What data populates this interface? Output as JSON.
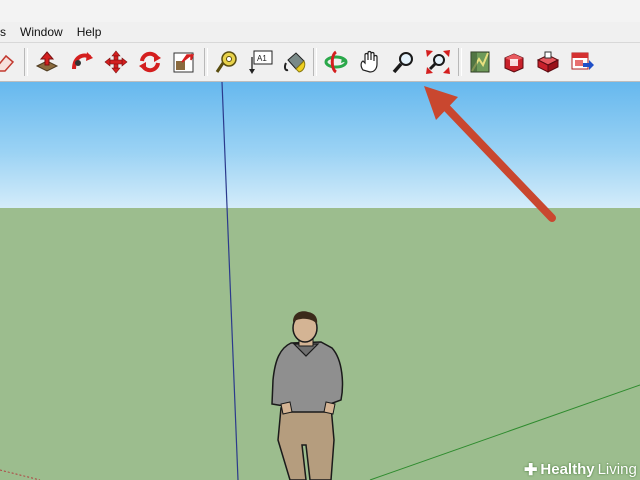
{
  "menu": {
    "items": [
      {
        "label": "s"
      },
      {
        "label": "Window"
      },
      {
        "label": "Help"
      }
    ]
  },
  "toolbar": {
    "tools": [
      {
        "icon": "eraser-icon"
      },
      {
        "icon": "push-pull-icon"
      },
      {
        "icon": "follow-me-icon"
      },
      {
        "icon": "move-icon"
      },
      {
        "icon": "rotate-icon"
      },
      {
        "icon": "scale-icon"
      },
      {
        "icon": "tape-measure-icon"
      },
      {
        "icon": "text-tool-icon",
        "text": "A1"
      },
      {
        "icon": "paint-bucket-icon"
      },
      {
        "icon": "orbit-icon"
      },
      {
        "icon": "pan-icon"
      },
      {
        "icon": "zoom-icon"
      },
      {
        "icon": "zoom-extents-icon"
      },
      {
        "icon": "add-location-icon"
      },
      {
        "icon": "get-models-icon"
      },
      {
        "icon": "share-model-icon"
      },
      {
        "icon": "send-to-google-earth-icon"
      }
    ]
  },
  "annotation": {
    "icon": "arrow-pointer-icon",
    "color": "#c9472f"
  },
  "watermark": {
    "brand_bold": "Healthy",
    "brand_thin": "Living"
  },
  "colors": {
    "sky_top": "#66b8ee",
    "ground": "#9cbd8e",
    "axis_blue": "#2b3a8c",
    "axis_green": "#2e8b2e",
    "accent_red": "#d41f1f"
  }
}
